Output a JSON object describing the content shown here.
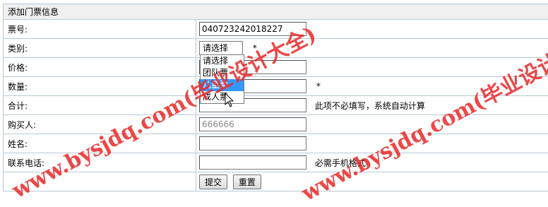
{
  "form": {
    "title": "添加门票信息",
    "fields": {
      "ticket_no": {
        "label": "票号:",
        "value": "040723242018227"
      },
      "category": {
        "label": "类别:",
        "selected": "请选择",
        "required_mark": "*",
        "options": [
          "请选择",
          "团队票",
          "儿童票",
          "成人票"
        ],
        "highlighted_option": "儿童票"
      },
      "price": {
        "label": "价格:",
        "value": ""
      },
      "quantity": {
        "label": "数量:",
        "value": "",
        "required_mark": "*"
      },
      "total": {
        "label": "合计:",
        "value": "",
        "hint": "此项不必填写，系统自动计算"
      },
      "buyer": {
        "label": "购买人:",
        "value": "666666"
      },
      "name": {
        "label": "姓名:",
        "value": ""
      },
      "phone": {
        "label": "联系电话:",
        "value": "",
        "hint": "必需手机格式"
      }
    },
    "buttons": {
      "submit": "提交",
      "reset": "重置"
    }
  },
  "watermark": {
    "text": "www.bysjdq.com(毕业设计大全)"
  },
  "colors": {
    "border": "#b9c9d4",
    "title_bg": "#f0f0f0",
    "highlight": "#3399ff",
    "watermark": "#e82828"
  }
}
